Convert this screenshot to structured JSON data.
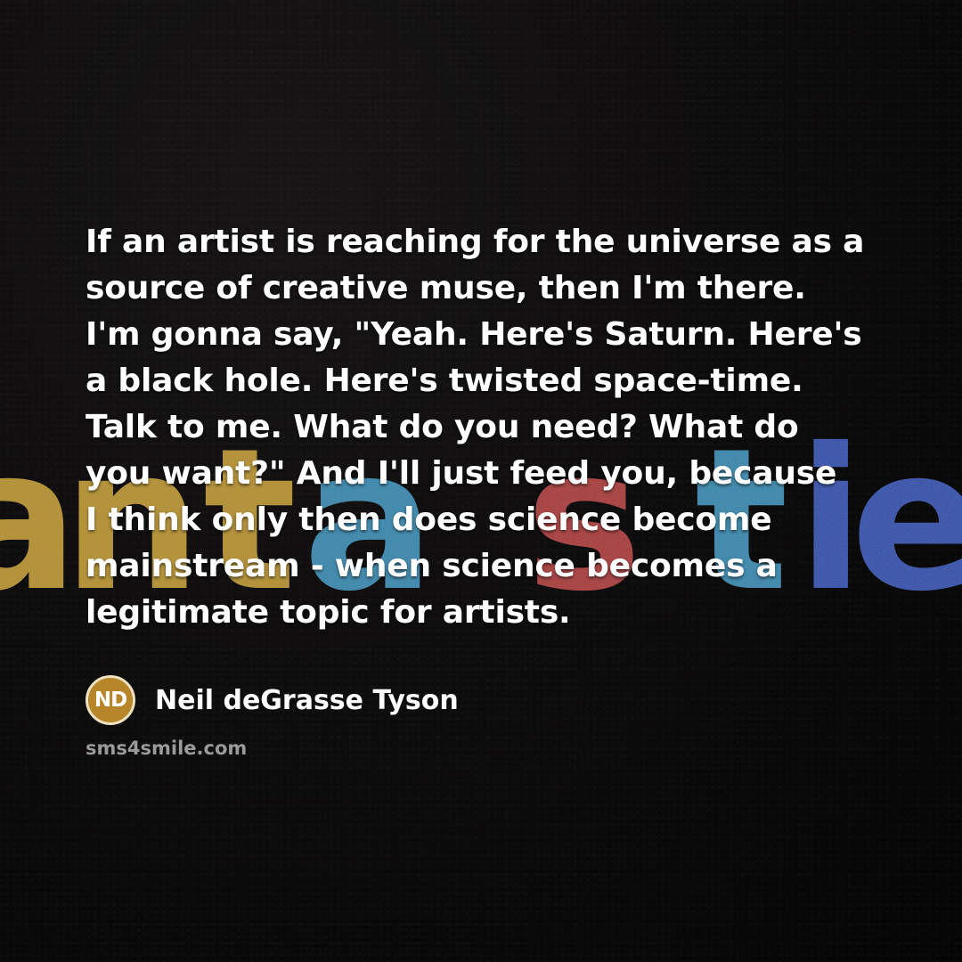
{
  "background": {
    "felt_letters": "antastic",
    "letter_colors": [
      "#e0b31c",
      "#d23a3a",
      "#35a8d8",
      "#2f5fd6"
    ]
  },
  "quote": {
    "lines": [
      "If an artist is reaching for the universe as a",
      "source of creative muse, then I'm there.",
      "I'm gonna say, \"Yeah. Here's Saturn. Here's",
      "a black hole. Here's twisted space-time.",
      "Talk to me. What do you need? What do",
      "you want?\" And I'll just feed you, because",
      "I think only then does science become",
      "mainstream - when science becomes a",
      "legitimate topic for artists."
    ]
  },
  "author": {
    "initials": "ND",
    "name": "Neil deGrasse Tyson",
    "badge_color": "#b8862a"
  },
  "site": "sms4smile.com"
}
